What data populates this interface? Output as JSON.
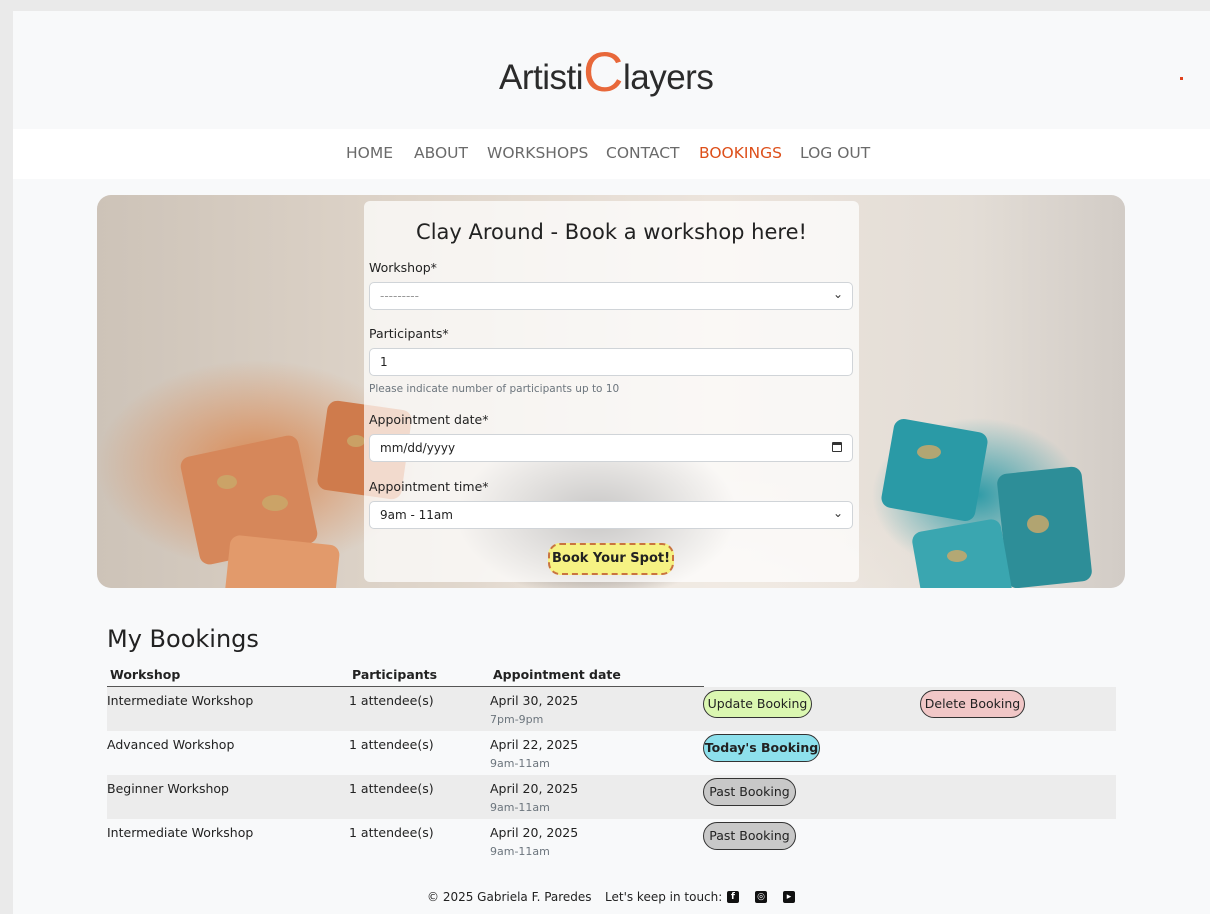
{
  "brand": {
    "logo_prefix": "Artisti",
    "logo_c": "C",
    "logo_suffix": "layers",
    "accent_color": "#e8683a"
  },
  "nav": {
    "items": [
      {
        "label": "HOME"
      },
      {
        "label": "ABOUT"
      },
      {
        "label": "WORKSHOPS"
      },
      {
        "label": "CONTACT"
      },
      {
        "label": "BOOKINGS"
      },
      {
        "label": "LOG OUT"
      }
    ],
    "active": "BOOKINGS"
  },
  "booking_form": {
    "title": "Clay Around - Book a workshop here!",
    "workshop_label": "Workshop*",
    "workshop_value": "---------",
    "participants_label": "Participants*",
    "participants_value": "1",
    "participants_help": "Please indicate number of participants up to 10",
    "date_label": "Appointment date*",
    "date_placeholder": "mm/dd/yyyy",
    "time_label": "Appointment time*",
    "time_value": "9am - 11am",
    "submit_label": "Book Your Spot!"
  },
  "bookings": {
    "title": "My Bookings",
    "headers": [
      "Workshop",
      "Participants",
      "Appointment date"
    ],
    "rows": [
      {
        "workshop": "Intermediate Workshop",
        "participants": "1 attendee(s)",
        "date": "April 30, 2025",
        "time": "7pm-9pm",
        "action": "Update Booking",
        "action2": "Delete Booking"
      },
      {
        "workshop": "Advanced Workshop",
        "participants": "1 attendee(s)",
        "date": "April 22, 2025",
        "time": "9am-11am",
        "action": "Today's Booking"
      },
      {
        "workshop": "Beginner Workshop",
        "participants": "1 attendee(s)",
        "date": "April 20, 2025",
        "time": "9am-11am",
        "action": "Past Booking"
      },
      {
        "workshop": "Intermediate Workshop",
        "participants": "1 attendee(s)",
        "date": "April 20, 2025",
        "time": "9am-11am",
        "action": "Past Booking"
      }
    ]
  },
  "footer": {
    "copyright": "© 2025 Gabriela F. Paredes",
    "keep_in_touch": "Let's keep in touch:",
    "social_icons": [
      "facebook-icon",
      "instagram-icon",
      "youtube-icon"
    ]
  }
}
